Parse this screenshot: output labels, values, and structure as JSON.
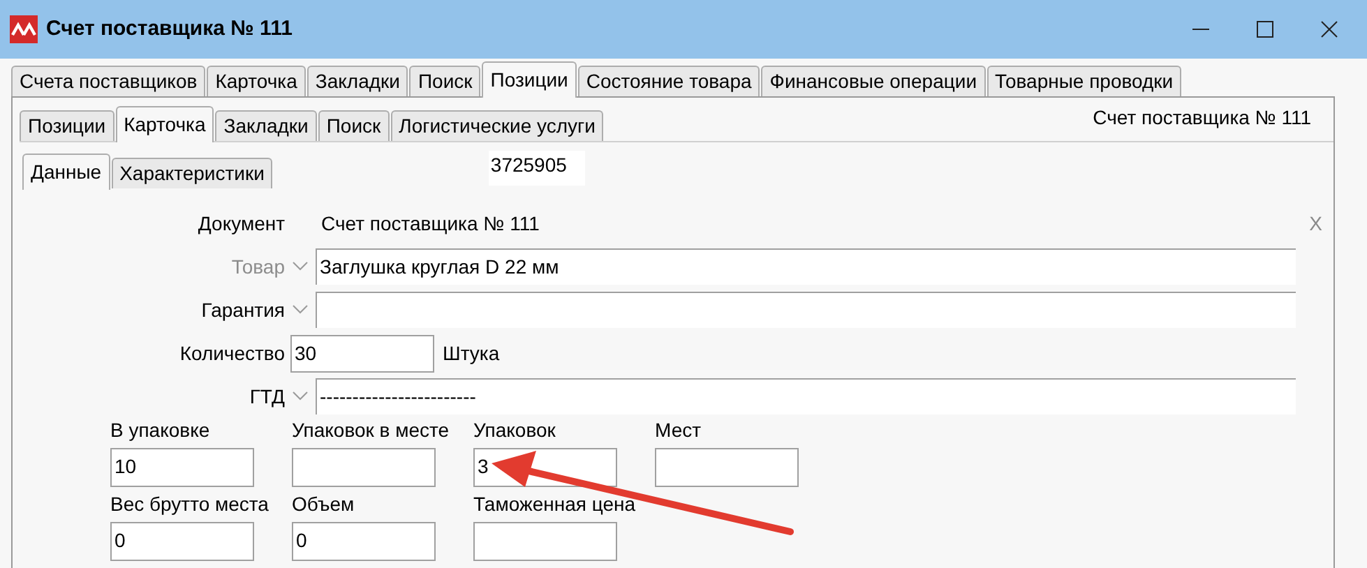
{
  "window": {
    "title": "Счет поставщика № 111"
  },
  "main_tabs": [
    {
      "label": "Счета поставщиков",
      "selected": false
    },
    {
      "label": "Карточка",
      "selected": false
    },
    {
      "label": "Закладки",
      "selected": false
    },
    {
      "label": "Поиск",
      "selected": false
    },
    {
      "label": "Позиции",
      "selected": true
    },
    {
      "label": "Состояние товара",
      "selected": false
    },
    {
      "label": "Финансовые операции",
      "selected": false
    },
    {
      "label": "Товарные проводки",
      "selected": false
    }
  ],
  "sub_tabs": [
    {
      "label": "Позиции",
      "selected": false
    },
    {
      "label": "Карточка",
      "selected": true
    },
    {
      "label": "Закладки",
      "selected": false
    },
    {
      "label": "Поиск",
      "selected": false
    },
    {
      "label": "Логистические услуги",
      "selected": false
    }
  ],
  "header_caption": "Счет поставщика № 111",
  "detail_tabs": [
    {
      "label": "Данные",
      "selected": true
    },
    {
      "label": "Характеристики",
      "selected": false
    }
  ],
  "record_id": "3725905",
  "form": {
    "document": {
      "label": "Документ",
      "value": "Счет поставщика № 111"
    },
    "clear_button": "X",
    "rows": [
      {
        "kind": "combo",
        "label": "Товар",
        "value": "Заглушка круглая D 22 мм",
        "disabled": true
      },
      {
        "kind": "combo",
        "label": "Гарантия",
        "disabled": false
      },
      {
        "kind": "quantity",
        "label": "Количество",
        "value": "30",
        "unit": "Штука",
        "disabled": false
      },
      {
        "kind": "combo",
        "label": "ГТД",
        "value": "------------------------",
        "disabled": false
      }
    ],
    "grid": [
      {
        "label": "В упаковке",
        "value": "10"
      },
      {
        "label": "Упаковок в месте"
      },
      {
        "label": "Упаковок",
        "value": "3"
      },
      {
        "label": "Мест"
      },
      {
        "label": "Вес брутто места",
        "value": "0"
      },
      {
        "label": "Объем",
        "value": "0"
      },
      {
        "label": "Таможенная цена"
      }
    ]
  }
}
